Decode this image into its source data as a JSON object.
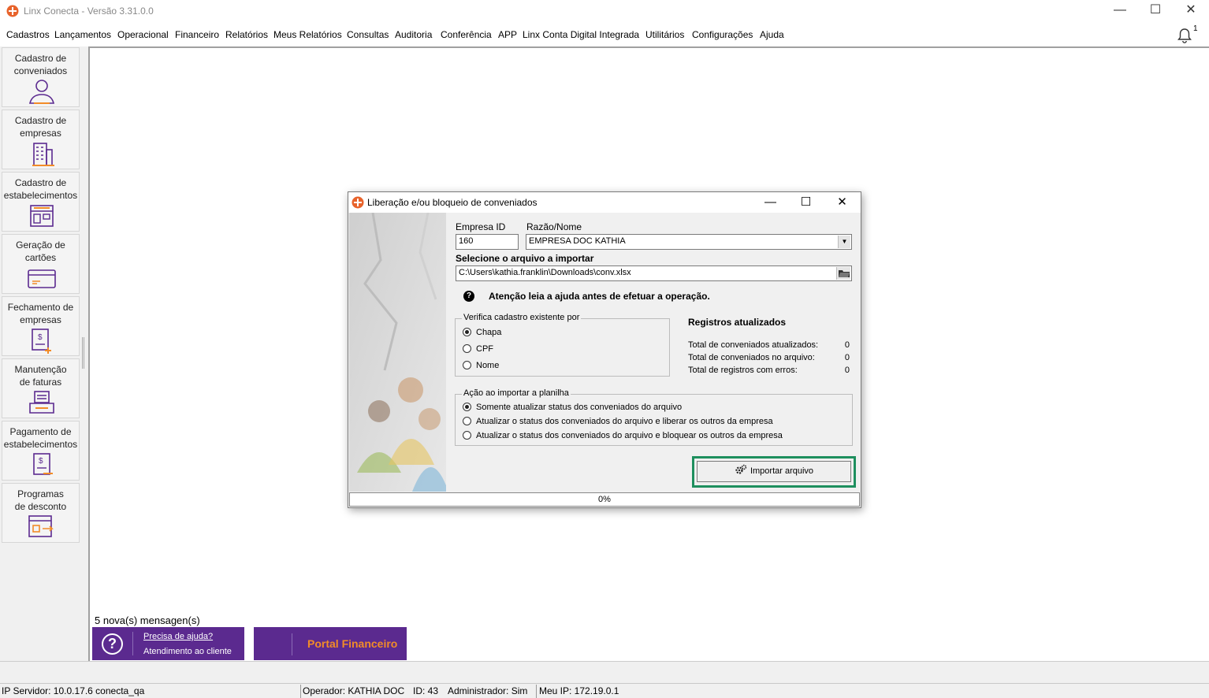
{
  "window": {
    "title": "Linx Conecta - Versão 3.31.0.0",
    "minimize": "—",
    "maximize": "☐",
    "close": "✕"
  },
  "menu": [
    "Cadastros",
    "Lançamentos",
    "Operacional",
    "Financeiro",
    "Relatórios",
    "Meus Relatórios",
    "Consultas",
    "Auditoria",
    "Conferência",
    "APP",
    "Linx Conta Digital Integrada",
    "Utilitários",
    "Configurações",
    "Ajuda"
  ],
  "notifications": {
    "icon": "bell-icon",
    "count": "1"
  },
  "sidebar": [
    {
      "line1": "Cadastro de",
      "line2": "conveniados",
      "icon": "person-icon"
    },
    {
      "line1": "Cadastro de",
      "line2": "empresas",
      "icon": "building-icon"
    },
    {
      "line1": "Cadastro de",
      "line2": "estabelecimentos",
      "icon": "store-icon"
    },
    {
      "line1": "Geração de",
      "line2": "cartões",
      "icon": "card-icon"
    },
    {
      "line1": "Fechamento de",
      "line2": "empresas",
      "icon": "invoice-close-icon"
    },
    {
      "line1": "Manutenção",
      "line2": "de faturas",
      "icon": "invoice-tray-icon"
    },
    {
      "line1": "Pagamento de",
      "line2": "estabelecimentos",
      "icon": "payment-doc-icon"
    },
    {
      "line1": "Programas",
      "line2": "de desconto",
      "icon": "discount-program-icon"
    }
  ],
  "messages": "5 nova(s) mensagen(s)",
  "help_banner": {
    "link": "Precisa de ajuda?",
    "sub": "Atendimento ao cliente",
    "icon": "?"
  },
  "portal": {
    "label": "Portal Financeiro"
  },
  "status": {
    "server": "IP Servidor: 10.0.17.6 conecta_qa",
    "operator": "Operador: KATHIA DOC",
    "id": "ID: 43",
    "admin": "Administrador: Sim",
    "ip": "Meu IP: 172.19.0.1"
  },
  "dialog": {
    "title": "Liberação e/ou bloqueio de conveniados",
    "empresa_id_label": "Empresa ID",
    "empresa_id_value": "160",
    "razao_label": "Razão/Nome",
    "razao_value": "EMPRESA DOC KATHIA",
    "file_label": "Selecione o arquivo a importar",
    "file_value": "C:\\Users\\kathia.franklin\\Downloads\\conv.xlsx",
    "attention": "Atenção leia a ajuda antes de efetuar a operação.",
    "verify_group": "Verifica cadastro existente por",
    "verify_options": [
      "Chapa",
      "CPF",
      "Nome"
    ],
    "verify_selected": "Chapa",
    "registros_title": "Registros atualizados",
    "stats": [
      {
        "label": "Total de conveniados atualizados:",
        "value": "0"
      },
      {
        "label": "Total de conveniados no arquivo:",
        "value": "0"
      },
      {
        "label": "Total de registros com erros:",
        "value": "0"
      }
    ],
    "action_group": "Ação ao importar a planilha",
    "action_options": [
      "Somente atualizar status dos conveniados do arquivo",
      "Atualizar o status dos conveniados do arquivo e liberar os outros da empresa",
      "Atualizar o status dos conveniados do arquivo e bloquear os outros da empresa"
    ],
    "action_selected": 0,
    "import_button": "Importar arquivo",
    "progress": "0%"
  },
  "colors": {
    "brand_purple": "#5b2a8f",
    "brand_orange": "#f28c28",
    "highlight_green": "#1e8f5e"
  }
}
